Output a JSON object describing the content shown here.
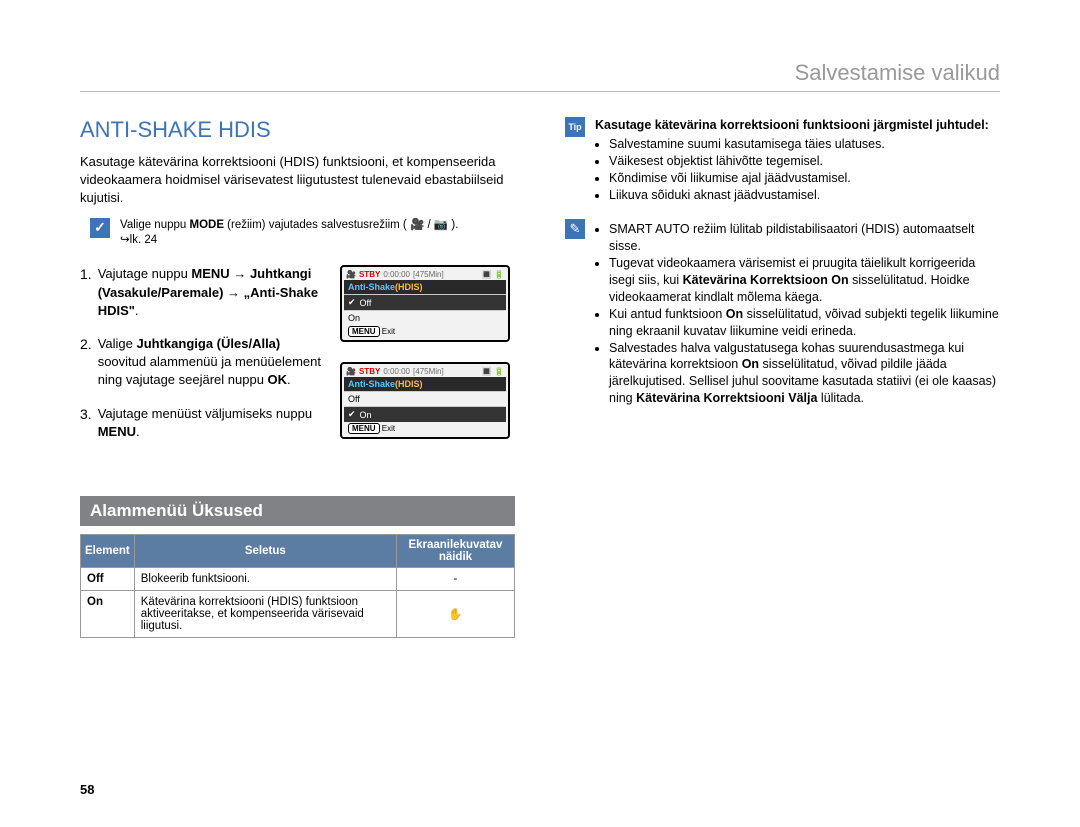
{
  "header": "Salvestamise valikud",
  "page_number": "58",
  "left": {
    "title": "ANTI-SHAKE HDIS",
    "intro": "Kasutage kätevärina korrektsiooni (HDIS) funktsiooni, et kompenseerida videokaamera hoidmisel värisevatest liigutustest tulenevaid ebastabiilseid kujutisi.",
    "note_line1_pre": "Valige nuppu ",
    "note_line1_mode": "MODE",
    "note_line1_post": " (režiim) vajutades salvestusrežiim ( 🎥 / 📷 ).",
    "note_line2": "↪lk. 24",
    "steps": [
      {
        "num": "1.",
        "text_pre": "Vajutage nuppu ",
        "bold1": "MENU",
        "arrow1": " → ",
        "bold2": "Juhtkangi (Vasakule/Paremale)",
        "arrow2": " → ",
        "bold3": "„Anti-Shake HDIS\"",
        "text_post": "."
      },
      {
        "num": "2.",
        "text_pre": "Valige ",
        "bold1": "Juhtkangiga (Üles/Alla)",
        "mid": " soovitud alammenüü ja menüüelement ning vajutage seejärel nuppu ",
        "bold2": "OK",
        "text_post": "."
      },
      {
        "num": "3.",
        "text_pre": "Vajutage menüüst väljumiseks nuppu ",
        "bold1": "MENU",
        "text_post": "."
      }
    ],
    "panel": {
      "stby": "STBY",
      "time": "0:00:00",
      "dur": "[475Min]",
      "heading_a": "Anti-Shake",
      "heading_b": "(HDIS)",
      "off": "Off",
      "on": "On",
      "menu": "MENU",
      "exit": "Exit"
    },
    "submenu": {
      "title": "Alammenüü Üksused",
      "th1": "Element",
      "th2": "Seletus",
      "th3": "Ekraanilekuvatav näidik",
      "rows": [
        {
          "item": "Off",
          "desc": "Blokeerib funktsiooni.",
          "ind": "-"
        },
        {
          "item": "On",
          "desc": "Kätevärina korrektsiooni (HDIS) funktsioon aktiveeritakse, et kompenseerida värisevaid liigutusi.",
          "ind": "✋"
        }
      ]
    }
  },
  "right": {
    "tip_bold": "Kasutage kätevärina korrektsiooni funktsiooni järgmistel juhtudel:",
    "tip_bullets": [
      "Salvestamine suumi kasutamisega täies ulatuses.",
      "Väikesest objektist lähivõtte tegemisel.",
      "Kõndimise või liikumise ajal jäädvustamisel.",
      "Liikuva sõiduki aknast jäädvustamisel."
    ],
    "pencil": {
      "b1": "SMART AUTO režiim lülitab pildistabilisaatori (HDIS) automaatselt sisse.",
      "b2_pre": "Tugevat videokaamera värisemist ei pruugita täielikult korrigeerida isegi siis, kui ",
      "b2_bold": "Kätevärina Korrektsioon On",
      "b2_post": " sisselülitatud. Hoidke videokaamerat kindlalt mõlema käega.",
      "b3_pre": "Kui antud funktsioon ",
      "b3_bold": "On",
      "b3_post": " sisselülitatud, võivad subjekti tegelik liikumine ning ekraanil kuvatav liikumine veidi erineda.",
      "b4_pre": "Salvestades halva valgustatusega kohas suurendusastmega kui kätevärina korrektsioon ",
      "b4_bold1": "On",
      "b4_mid": " sisselülitatud, võivad pildile jääda järelkujutised. Sellisel juhul soovitame kasutada statiivi (ei ole kaasas) ning ",
      "b4_bold2": "Kätevärina Korrektsiooni Välja",
      "b4_post": " lülitada."
    }
  }
}
